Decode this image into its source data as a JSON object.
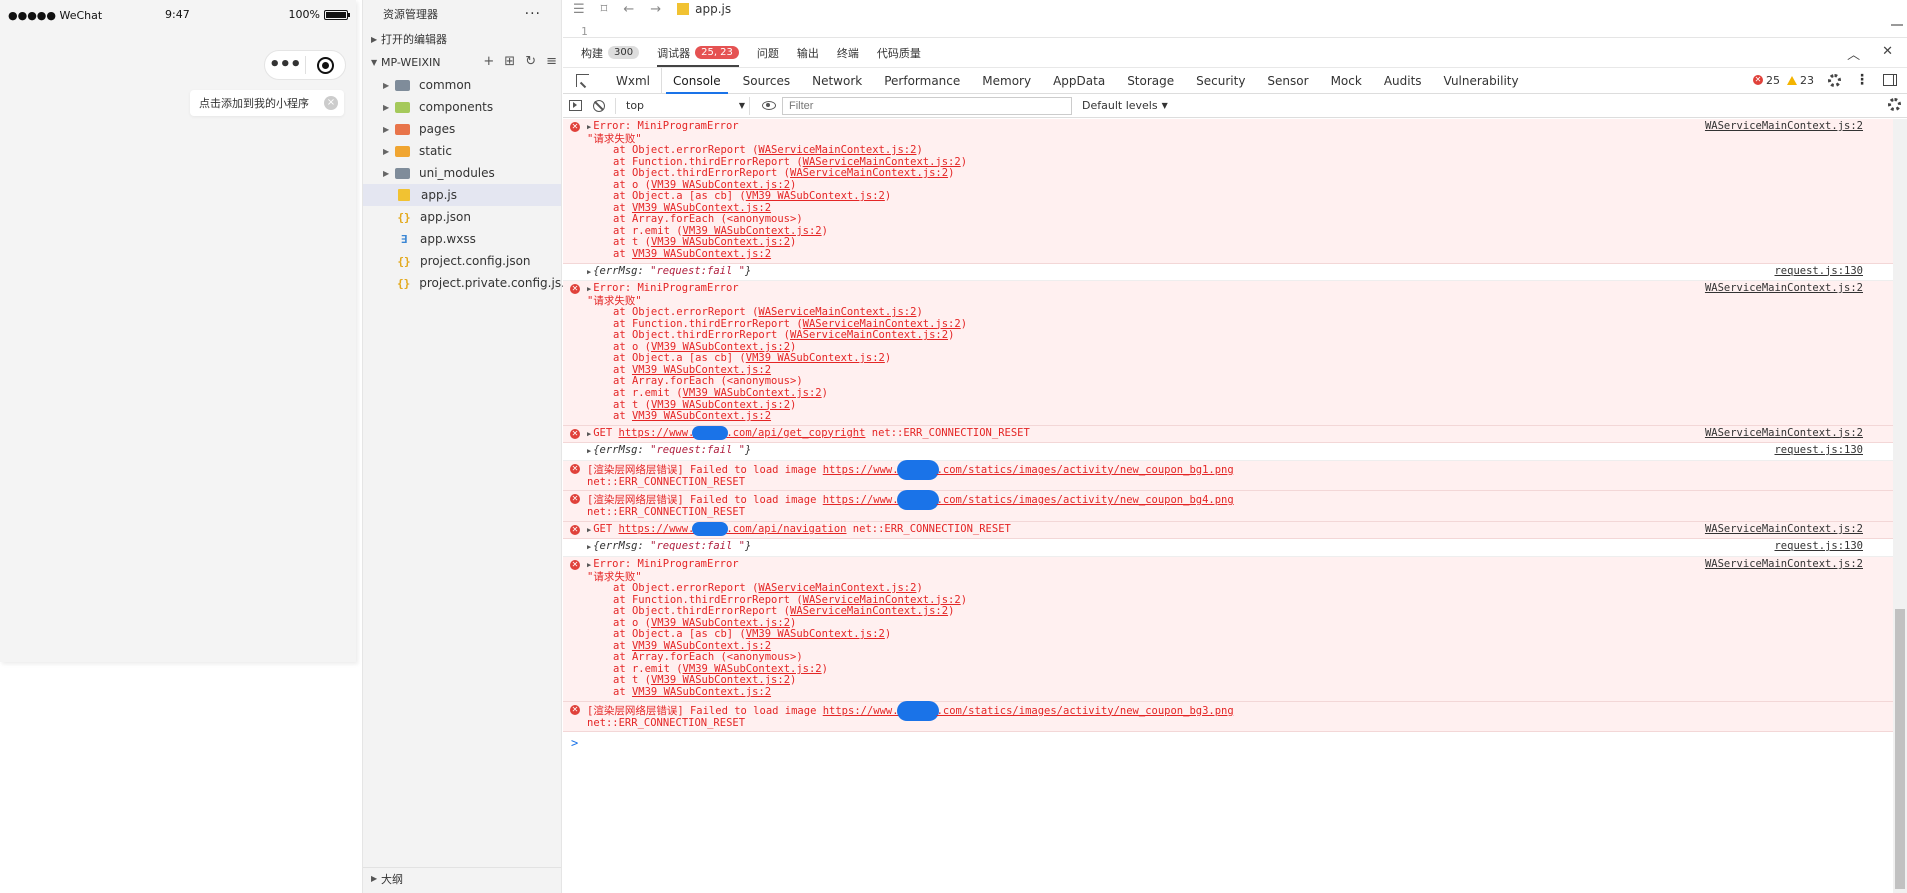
{
  "simulator": {
    "carrier": "●●●●● WeChat",
    "time": "9:47",
    "battery": "100%",
    "add_tip": "点击添加到我的小程序"
  },
  "explorer": {
    "title": "资源管理器",
    "open_editors": "打开的编辑器",
    "project": "MP-WEIXIN",
    "folders": [
      {
        "name": "common",
        "color": "#7f8c9a"
      },
      {
        "name": "components",
        "color": "#a5c95b"
      },
      {
        "name": "pages",
        "color": "#e8744a"
      },
      {
        "name": "static",
        "color": "#f0a531"
      },
      {
        "name": "uni_modules",
        "color": "#7f8c9a"
      }
    ],
    "files": [
      {
        "name": "app.js",
        "type": "js"
      },
      {
        "name": "app.json",
        "type": "json"
      },
      {
        "name": "app.wxss",
        "type": "wxss"
      },
      {
        "name": "project.config.json",
        "type": "json"
      },
      {
        "name": "project.private.config.js...",
        "type": "json"
      }
    ],
    "outline": "大纲"
  },
  "editor": {
    "tab": "app.js",
    "line": "1"
  },
  "panel_tabs": [
    {
      "label": "构建",
      "badge": "300",
      "badge_style": "gray"
    },
    {
      "label": "调试器",
      "badge": "25, 23",
      "badge_style": "red",
      "active": true
    },
    {
      "label": "问题"
    },
    {
      "label": "输出"
    },
    {
      "label": "终端"
    },
    {
      "label": "代码质量"
    }
  ],
  "devtools": {
    "tabs": [
      "Wxml",
      "Console",
      "Sources",
      "Network",
      "Performance",
      "Memory",
      "AppData",
      "Storage",
      "Security",
      "Sensor",
      "Mock",
      "Audits",
      "Vulnerability"
    ],
    "active_tab": "Console",
    "error_count": "25",
    "warning_count": "23"
  },
  "console_toolbar": {
    "context": "top",
    "filter_placeholder": "Filter",
    "levels": "Default levels"
  },
  "log": {
    "mp_error_title": "Error: MiniProgramError",
    "mp_error_msg": "\"请求失败\"",
    "mp_src": "WAServiceMainContext.js:2",
    "fail_src": "request.js:130",
    "stack": [
      [
        "at Object.errorReport (",
        "WAServiceMainContext.js:2",
        ")"
      ],
      [
        "at Function.thirdErrorReport (",
        "WAServiceMainContext.js:2",
        ")"
      ],
      [
        "at Object.thirdErrorReport (",
        "WAServiceMainContext.js:2",
        ")"
      ],
      [
        "at o (",
        "VM39 WASubContext.js:2",
        ")"
      ],
      [
        "at Object.a [as cb] (",
        "VM39 WASubContext.js:2",
        ")"
      ],
      [
        "at ",
        "VM39 WASubContext.js:2",
        ""
      ],
      [
        "at Array.forEach (<anonymous>)",
        "",
        ""
      ],
      [
        "at r.emit (",
        "VM39 WASubContext.js:2",
        ")"
      ],
      [
        "at t (",
        "VM39 WASubContext.js:2",
        ")"
      ],
      [
        "at ",
        "VM39 WASubContext.js:2",
        ""
      ]
    ],
    "fail_obj_key": "{errMsg: ",
    "fail_obj_val": "\"request:fail \"",
    "fail_obj_end": "}",
    "get1_prefix": "GET ",
    "get1_url_a": "https://www.",
    "get1_url_b": ".com/api/get_copyright",
    "get2_url_b": ".com/api/navigation",
    "reset": " net::ERR_CONNECTION_RESET",
    "reset_line": "net::ERR_CONNECTION_RESET",
    "img_prefix": "[渲染层网络层错误] Failed to load image ",
    "img1_url_b": ".com/statics/images/activity/new_coupon_bg1.png",
    "img2_url_b": ".com/statics/images/activity/new_coupon_bg4.png",
    "img3_url_b": ".com/statics/images/activity/new_coupon_bg3.png",
    "prompt": ">"
  }
}
